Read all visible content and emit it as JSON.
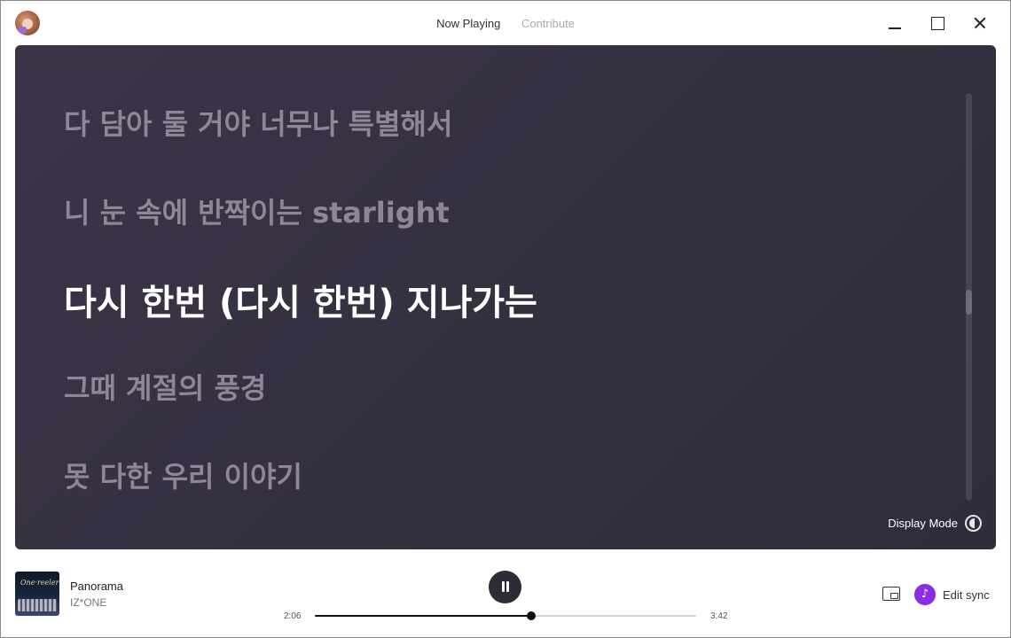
{
  "titlebar": {
    "tabs": [
      {
        "label": "Now Playing",
        "active": true
      },
      {
        "label": "Contribute",
        "active": false
      }
    ],
    "controls": [
      "minimize-icon",
      "maximize-icon",
      "close-icon"
    ]
  },
  "lyrics": {
    "lines": [
      {
        "text": "다 담아 둘 거야 너무나 특별해서",
        "current": false
      },
      {
        "text": "니 눈 속에 반짝이는 starlight",
        "current": false
      },
      {
        "text": "다시 한번 (다시 한번) 지나가는",
        "current": true
      },
      {
        "text": "그때 계절의 풍경",
        "current": false
      },
      {
        "text": "못 다한 우리 이야기",
        "current": false
      }
    ],
    "display_mode_label": "Display Mode",
    "scroll_position": 0.48
  },
  "player": {
    "track_title": "Panorama",
    "artist": "IZ*ONE",
    "elapsed": "2:06",
    "duration": "3:42",
    "progress": 0.568,
    "state": "playing",
    "edit_sync_label": "Edit sync"
  },
  "colors": {
    "panel_bg": "#352f41",
    "lyric_current": "#ffffff",
    "lyric_dim": "#8d8796",
    "accent": "#8b2be2",
    "play_button": "#2e2a36"
  }
}
